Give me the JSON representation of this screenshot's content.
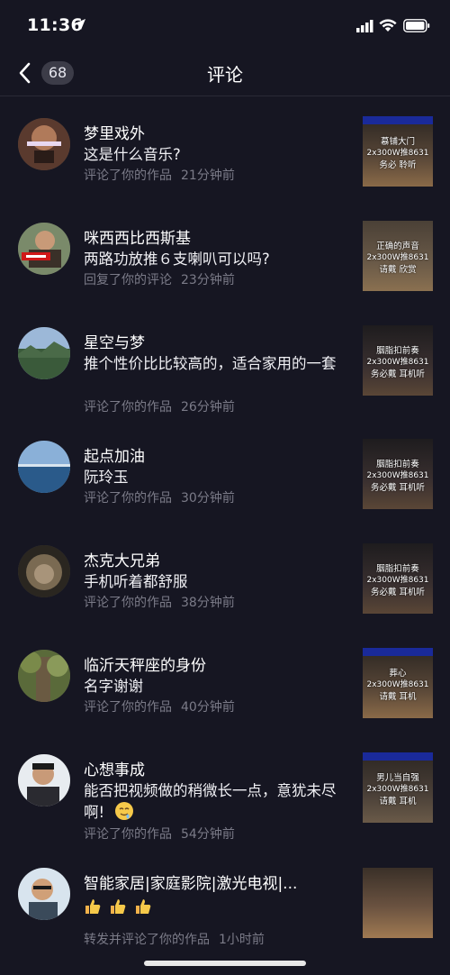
{
  "status": {
    "time": "11:36"
  },
  "nav": {
    "badge": "68",
    "title": "评论"
  },
  "items": [
    {
      "name": "梦里戏外",
      "comment": "这是什么音乐?",
      "action": "评论了你的作品",
      "time": "21分钟前",
      "thumb": {
        "t1": "慕铺大门",
        "t2": "2x300W推8631",
        "t3": "务必  聆听"
      }
    },
    {
      "name": "咪西西比西斯基",
      "comment": "两路功放推６支喇叭可以吗?",
      "action": "回复了你的评论",
      "time": "23分钟前",
      "thumb": {
        "t1": "正确的声音",
        "t2": "2x300W推8631",
        "t3": "请戴  欣赏"
      }
    },
    {
      "name": "星空与梦",
      "comment": "推个性价比比较高的，适合家用的一套",
      "action": "评论了你的作品",
      "time": "26分钟前",
      "thumb": {
        "t1": "胭脂扣前奏",
        "t2": "2x300W推8631",
        "t3": "务必戴  耳机听"
      }
    },
    {
      "name": "起点加油",
      "comment": "阮玲玉",
      "action": "评论了你的作品",
      "time": "30分钟前",
      "thumb": {
        "t1": "胭脂扣前奏",
        "t2": "2x300W推8631",
        "t3": "务必戴  耳机听"
      }
    },
    {
      "name": "杰克大兄弟",
      "comment": "手机听着都舒服",
      "action": "评论了你的作品",
      "time": "38分钟前",
      "thumb": {
        "t1": "胭脂扣前奏",
        "t2": "2x300W推8631",
        "t3": "务必戴  耳机听"
      }
    },
    {
      "name": "临沂天秤座的身份",
      "comment": "名字谢谢",
      "action": "评论了你的作品",
      "time": "40分钟前",
      "thumb": {
        "t1": "葬心",
        "t2": "2x300W推8631",
        "t3": "请戴  耳机"
      }
    },
    {
      "name": "心想事成",
      "comment": "能否把视频做的稍微长一点，意犹未尽啊!",
      "action": "评论了你的作品",
      "time": "54分钟前",
      "thumb": {
        "t1": "男儿当自强",
        "t2": "2x300W推8631",
        "t3": "请戴  耳机"
      }
    },
    {
      "name": "智能家居|家庭影院|激光电视|...",
      "comment": "",
      "action": "转发并评论了你的作品",
      "time": "1小时前",
      "thumb": {
        "t1": "",
        "t2": "",
        "t3": ""
      }
    }
  ]
}
